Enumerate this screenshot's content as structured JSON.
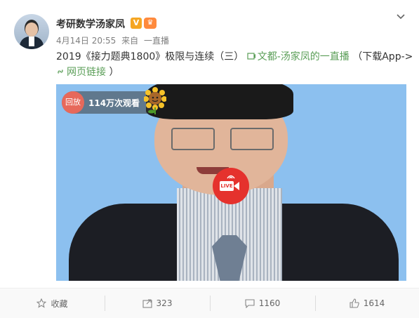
{
  "post": {
    "username": "考研数学汤家凤",
    "verified_mark": "V",
    "timestamp": "4月14日 20:55",
    "source_prefix": "来自",
    "source": "一直播",
    "text": "2019《接力题典1800》极限与连续（三）",
    "link_text": "文都-汤家凤的一直播",
    "link_suffix": "（下载App->",
    "web_link": "网页链接",
    "web_link_suffix": "）"
  },
  "video": {
    "replay_label": "回放",
    "views": "114万次观看",
    "live_label": "LIVE"
  },
  "actions": {
    "favorite": "收藏",
    "repost": "323",
    "comment": "1160",
    "like": "1614"
  },
  "colors": {
    "link": "#5a9e57",
    "verified": "#f5a623",
    "live": "#e5322d",
    "replay": "#e7695b",
    "video_bg": "#8cc0ef"
  }
}
